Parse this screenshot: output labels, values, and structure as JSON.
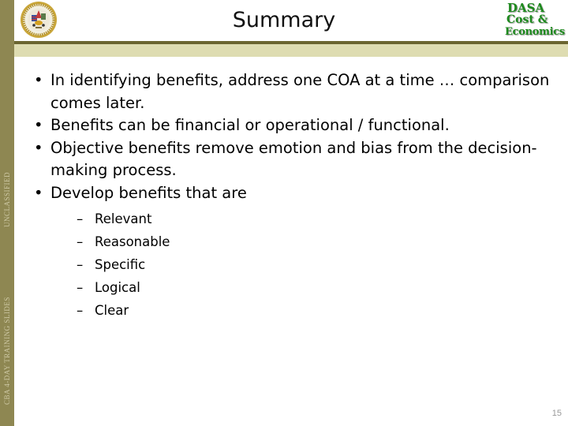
{
  "slide": {
    "title": "Summary",
    "sidebar": {
      "classification": "UNCLASSIFIED",
      "course": "CBA 4-DAY TRAINING SLIDES"
    },
    "logo": {
      "line1": "DASA",
      "line2": "Cost &",
      "line3": "Economics"
    },
    "seal_icon": "army-seal-icon",
    "bullets": [
      {
        "text": "In identifying benefits, address one COA at a time … comparison comes later."
      },
      {
        "text": "Benefits can be financial or operational / functional."
      },
      {
        "text": "Objective benefits remove emotion and bias from the decision-making process."
      },
      {
        "text": "Develop benefits that are"
      }
    ],
    "sub_bullets": [
      {
        "text": "Relevant"
      },
      {
        "text": "Reasonable"
      },
      {
        "text": "Specific"
      },
      {
        "text": "Logical"
      },
      {
        "text": "Clear"
      }
    ],
    "bullet_glyph": "•",
    "dash_glyph": "–",
    "page_number": "15",
    "colors": {
      "sidebar": "#8e8752",
      "header_line": "#6b6530",
      "header_band": "#dedcb1",
      "logo_text": "#1e8a1e"
    }
  }
}
